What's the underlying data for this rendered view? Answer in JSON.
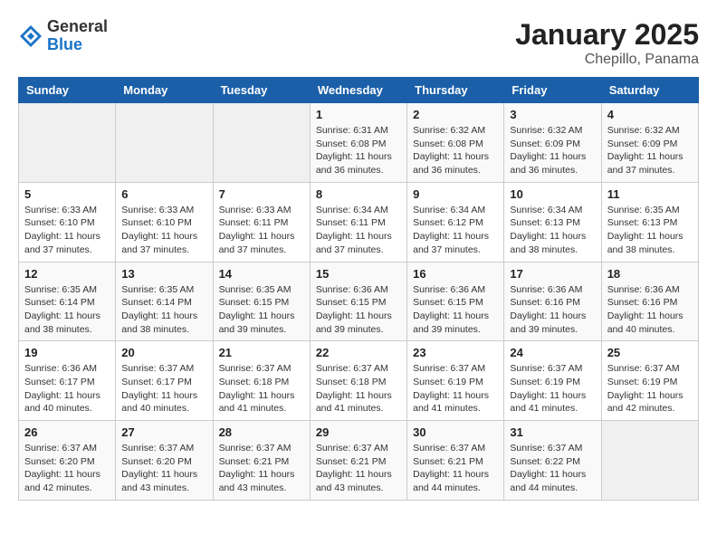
{
  "logo": {
    "general": "General",
    "blue": "Blue"
  },
  "title": {
    "month_year": "January 2025",
    "location": "Chepillo, Panama"
  },
  "weekdays": [
    "Sunday",
    "Monday",
    "Tuesday",
    "Wednesday",
    "Thursday",
    "Friday",
    "Saturday"
  ],
  "weeks": [
    [
      {
        "day": "",
        "info": ""
      },
      {
        "day": "",
        "info": ""
      },
      {
        "day": "",
        "info": ""
      },
      {
        "day": "1",
        "info": "Sunrise: 6:31 AM\nSunset: 6:08 PM\nDaylight: 11 hours\nand 36 minutes."
      },
      {
        "day": "2",
        "info": "Sunrise: 6:32 AM\nSunset: 6:08 PM\nDaylight: 11 hours\nand 36 minutes."
      },
      {
        "day": "3",
        "info": "Sunrise: 6:32 AM\nSunset: 6:09 PM\nDaylight: 11 hours\nand 36 minutes."
      },
      {
        "day": "4",
        "info": "Sunrise: 6:32 AM\nSunset: 6:09 PM\nDaylight: 11 hours\nand 37 minutes."
      }
    ],
    [
      {
        "day": "5",
        "info": "Sunrise: 6:33 AM\nSunset: 6:10 PM\nDaylight: 11 hours\nand 37 minutes."
      },
      {
        "day": "6",
        "info": "Sunrise: 6:33 AM\nSunset: 6:10 PM\nDaylight: 11 hours\nand 37 minutes."
      },
      {
        "day": "7",
        "info": "Sunrise: 6:33 AM\nSunset: 6:11 PM\nDaylight: 11 hours\nand 37 minutes."
      },
      {
        "day": "8",
        "info": "Sunrise: 6:34 AM\nSunset: 6:11 PM\nDaylight: 11 hours\nand 37 minutes."
      },
      {
        "day": "9",
        "info": "Sunrise: 6:34 AM\nSunset: 6:12 PM\nDaylight: 11 hours\nand 37 minutes."
      },
      {
        "day": "10",
        "info": "Sunrise: 6:34 AM\nSunset: 6:13 PM\nDaylight: 11 hours\nand 38 minutes."
      },
      {
        "day": "11",
        "info": "Sunrise: 6:35 AM\nSunset: 6:13 PM\nDaylight: 11 hours\nand 38 minutes."
      }
    ],
    [
      {
        "day": "12",
        "info": "Sunrise: 6:35 AM\nSunset: 6:14 PM\nDaylight: 11 hours\nand 38 minutes."
      },
      {
        "day": "13",
        "info": "Sunrise: 6:35 AM\nSunset: 6:14 PM\nDaylight: 11 hours\nand 38 minutes."
      },
      {
        "day": "14",
        "info": "Sunrise: 6:35 AM\nSunset: 6:15 PM\nDaylight: 11 hours\nand 39 minutes."
      },
      {
        "day": "15",
        "info": "Sunrise: 6:36 AM\nSunset: 6:15 PM\nDaylight: 11 hours\nand 39 minutes."
      },
      {
        "day": "16",
        "info": "Sunrise: 6:36 AM\nSunset: 6:15 PM\nDaylight: 11 hours\nand 39 minutes."
      },
      {
        "day": "17",
        "info": "Sunrise: 6:36 AM\nSunset: 6:16 PM\nDaylight: 11 hours\nand 39 minutes."
      },
      {
        "day": "18",
        "info": "Sunrise: 6:36 AM\nSunset: 6:16 PM\nDaylight: 11 hours\nand 40 minutes."
      }
    ],
    [
      {
        "day": "19",
        "info": "Sunrise: 6:36 AM\nSunset: 6:17 PM\nDaylight: 11 hours\nand 40 minutes."
      },
      {
        "day": "20",
        "info": "Sunrise: 6:37 AM\nSunset: 6:17 PM\nDaylight: 11 hours\nand 40 minutes."
      },
      {
        "day": "21",
        "info": "Sunrise: 6:37 AM\nSunset: 6:18 PM\nDaylight: 11 hours\nand 41 minutes."
      },
      {
        "day": "22",
        "info": "Sunrise: 6:37 AM\nSunset: 6:18 PM\nDaylight: 11 hours\nand 41 minutes."
      },
      {
        "day": "23",
        "info": "Sunrise: 6:37 AM\nSunset: 6:19 PM\nDaylight: 11 hours\nand 41 minutes."
      },
      {
        "day": "24",
        "info": "Sunrise: 6:37 AM\nSunset: 6:19 PM\nDaylight: 11 hours\nand 41 minutes."
      },
      {
        "day": "25",
        "info": "Sunrise: 6:37 AM\nSunset: 6:19 PM\nDaylight: 11 hours\nand 42 minutes."
      }
    ],
    [
      {
        "day": "26",
        "info": "Sunrise: 6:37 AM\nSunset: 6:20 PM\nDaylight: 11 hours\nand 42 minutes."
      },
      {
        "day": "27",
        "info": "Sunrise: 6:37 AM\nSunset: 6:20 PM\nDaylight: 11 hours\nand 43 minutes."
      },
      {
        "day": "28",
        "info": "Sunrise: 6:37 AM\nSunset: 6:21 PM\nDaylight: 11 hours\nand 43 minutes."
      },
      {
        "day": "29",
        "info": "Sunrise: 6:37 AM\nSunset: 6:21 PM\nDaylight: 11 hours\nand 43 minutes."
      },
      {
        "day": "30",
        "info": "Sunrise: 6:37 AM\nSunset: 6:21 PM\nDaylight: 11 hours\nand 44 minutes."
      },
      {
        "day": "31",
        "info": "Sunrise: 6:37 AM\nSunset: 6:22 PM\nDaylight: 11 hours\nand 44 minutes."
      },
      {
        "day": "",
        "info": ""
      }
    ]
  ]
}
